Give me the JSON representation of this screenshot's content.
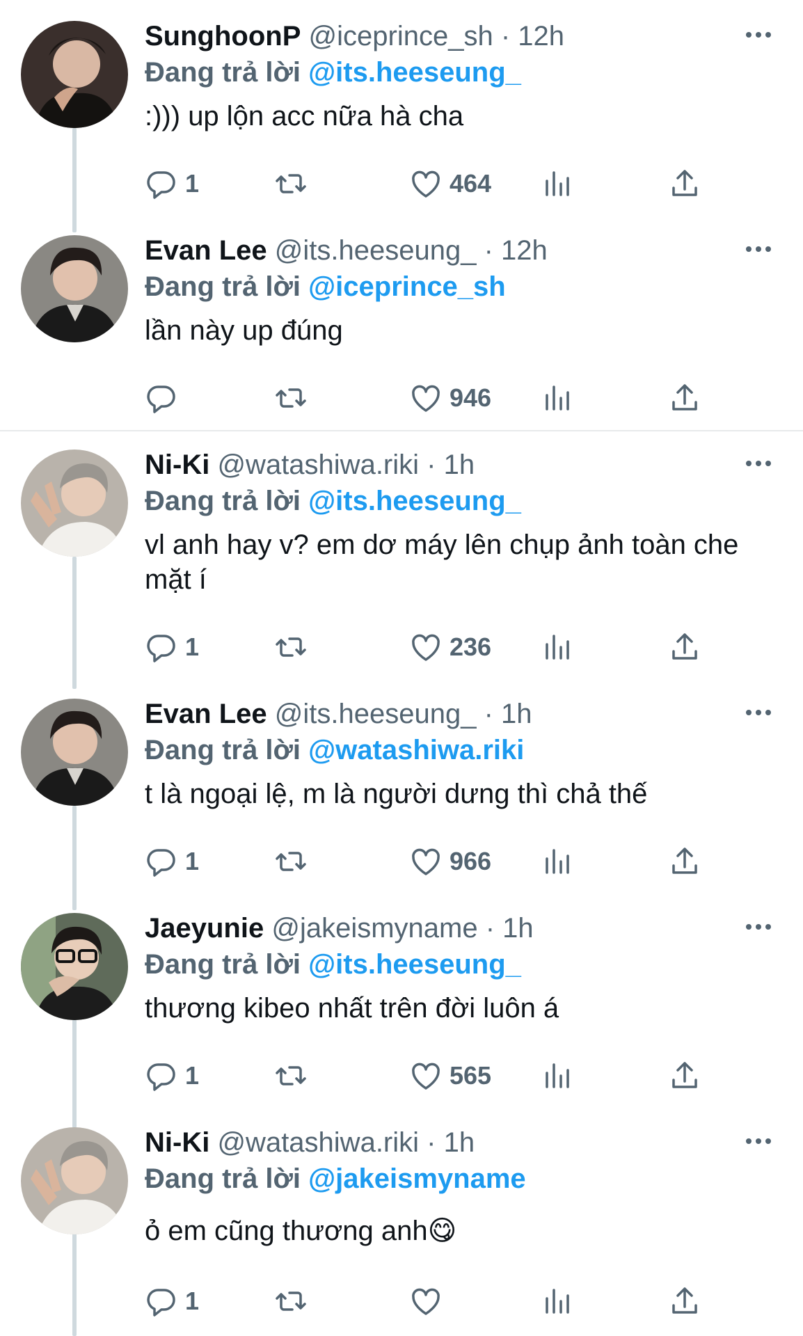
{
  "reply_prefix": "Đang trả lời",
  "tweets": [
    {
      "name": "SunghoonP",
      "handle": "@iceprince_sh",
      "time": "· 12h",
      "reply_to": "@its.heeseung_",
      "text": ":))) up lộn acc nữa hà cha",
      "replies": "1",
      "likes": "464",
      "avatar": "avatar-sunghoon"
    },
    {
      "name": "Evan Lee",
      "handle": "@its.heeseung_",
      "time": "· 12h",
      "reply_to": "@iceprince_sh",
      "text": "lần này up đúng",
      "replies": "",
      "likes": "946",
      "avatar": "avatar-evan"
    },
    {
      "name": "Ni-Ki",
      "handle": "@watashiwa.riki",
      "time": "· 1h",
      "reply_to": "@its.heeseung_",
      "text": "vl anh hay v? em dơ máy lên chụp ảnh toàn che mặt í",
      "replies": "1",
      "likes": "236",
      "avatar": "avatar-niki"
    },
    {
      "name": "Evan Lee",
      "handle": "@its.heeseung_",
      "time": "· 1h",
      "reply_to": "@watashiwa.riki",
      "text": "t là ngoại lệ, m là người dưng thì chả thế",
      "replies": "1",
      "likes": "966",
      "avatar": "avatar-evan"
    },
    {
      "name": "Jaeyunie",
      "handle": "@jakeismyname",
      "time": "· 1h",
      "reply_to": "@its.heeseung_",
      "text": "thương kibeo nhất trên đời luôn á",
      "replies": "1",
      "likes": "565",
      "avatar": "avatar-jaeyun"
    },
    {
      "name": "Ni-Ki",
      "handle": "@watashiwa.riki",
      "time": "· 1h",
      "reply_to": "@jakeismyname",
      "text": "ỏ em cũng thương anh😋",
      "replies": "1",
      "likes": "",
      "avatar": "avatar-niki"
    }
  ],
  "colors": {
    "accent": "#1d9bf0",
    "secondary_text": "#536471",
    "primary_text": "#0f1419",
    "thread_line": "#cfd9de"
  },
  "icons": {
    "reply": "reply-icon",
    "retweet": "retweet-icon",
    "like": "heart-icon",
    "views": "views-chart-icon",
    "share": "share-icon",
    "more": "more-options-icon"
  }
}
